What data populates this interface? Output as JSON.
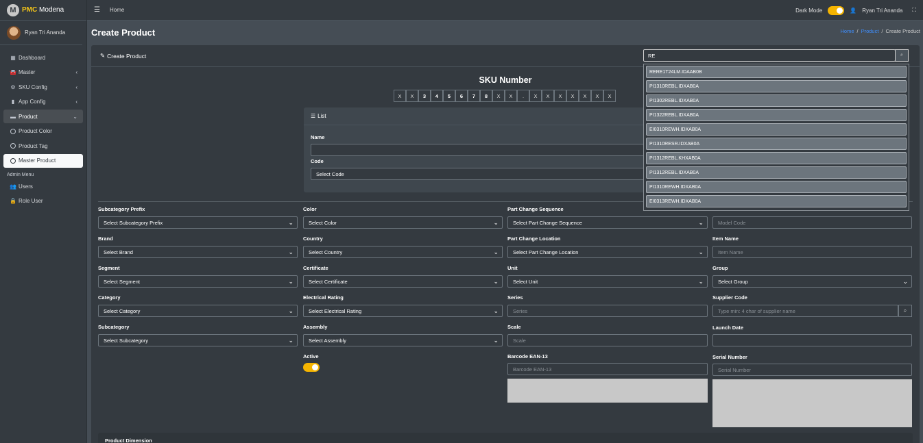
{
  "brand": {
    "strong": "PMC",
    "rest": " Modena",
    "logo_letter": "M"
  },
  "user": {
    "name": "Ryan Tri Ananda"
  },
  "sidebar": {
    "items": [
      {
        "label": "Dashboard",
        "icon": "grid-icon"
      },
      {
        "label": "Master",
        "icon": "car-icon"
      },
      {
        "label": "SKU Config",
        "icon": "gear-icon"
      },
      {
        "label": "App Config",
        "icon": "phone-icon"
      },
      {
        "label": "Product",
        "icon": "box-icon"
      },
      {
        "label": "Product Color",
        "icon": "circle-icon"
      },
      {
        "label": "Product Tag",
        "icon": "circle-icon"
      },
      {
        "label": "Master Product",
        "icon": "circle-icon"
      }
    ],
    "admin_header": "Admin Menu",
    "admin_items": [
      {
        "label": "Users",
        "icon": "users-icon"
      },
      {
        "label": "Role User",
        "icon": "lock-icon"
      }
    ]
  },
  "topbar": {
    "home": "Home",
    "dark_mode": "Dark Mode",
    "user": "Ryan Tri Ananda"
  },
  "page": {
    "title": "Create Product",
    "breadcrumb": [
      "Home",
      "Product",
      "Create Product"
    ]
  },
  "card": {
    "title": "Create Product"
  },
  "sku": {
    "title": "SKU Number",
    "chars": [
      "X",
      "X",
      "3",
      "4",
      "5",
      "6",
      "7",
      "8",
      "X",
      "X",
      ".",
      "X",
      "X",
      "X",
      "X",
      "X",
      "X",
      "X"
    ]
  },
  "list": {
    "title": "List",
    "name_label": "Name",
    "name_value": "",
    "code_label": "Code",
    "code_value": "Select Code"
  },
  "form": {
    "col1": [
      {
        "label": "Subcategory Prefix",
        "value": "Select Subcategory Prefix"
      },
      {
        "label": "Brand",
        "value": "Select Brand"
      },
      {
        "label": "Segment",
        "value": "Select Segment"
      },
      {
        "label": "Category",
        "value": "Select Category"
      },
      {
        "label": "Subcategory",
        "value": "Select Subcategory"
      }
    ],
    "col2": [
      {
        "label": "Color",
        "value": "Select Color"
      },
      {
        "label": "Country",
        "value": "Select Country"
      },
      {
        "label": "Certificate",
        "value": "Select Certificate"
      },
      {
        "label": "Electrical Rating",
        "value": "Select Electrical Rating"
      },
      {
        "label": "Assembly",
        "value": "Select Assembly"
      }
    ],
    "active_label": "Active",
    "col3": [
      {
        "label": "Part Change Sequence",
        "value": "Select Part Change Sequence"
      },
      {
        "label": "Part Change Location",
        "value": "Select Part Change Location"
      },
      {
        "label": "Unit",
        "value": "Select Unit"
      },
      {
        "label": "Series",
        "placeholder": "Series"
      },
      {
        "label": "Scale",
        "placeholder": "Scale"
      },
      {
        "label": "Barcode EAN-13",
        "placeholder": "Barcode EAN-13"
      }
    ],
    "col4": [
      {
        "label": "Model Code",
        "placeholder": "Model Code"
      },
      {
        "label": "Item Name",
        "placeholder": "Item Name"
      },
      {
        "label": "Group",
        "value": "Select Group"
      },
      {
        "label": "Supplier Code",
        "placeholder": "Type min: 4 char of supplier name"
      },
      {
        "label": "Launch Date",
        "placeholder": ""
      },
      {
        "label": "Serial Number",
        "placeholder": "Serial Number"
      }
    ],
    "dimension_title": "Product Dimension"
  },
  "dropdown": {
    "query": "RE",
    "results": [
      "RERE1T24LM.IDAAB0B",
      "PI1310REBL.IDXAB0A",
      "PI1302REBL.IDXAB0A",
      "PI1322REBL.IDXAB0A",
      "EI0310REWH.IDXAB0A",
      "PI1310RESR.IDXAB0A",
      "PI1312REBL.KHXAB0A",
      "PI1312REBL.IDXAB0A",
      "PI1310REWH.IDXAB0A",
      "EI0313REWH.IDXAB0A"
    ]
  },
  "colors": {
    "accent": "#f5b400",
    "link": "#3f8efc",
    "bg": "#454d55",
    "panel": "#343a40"
  }
}
